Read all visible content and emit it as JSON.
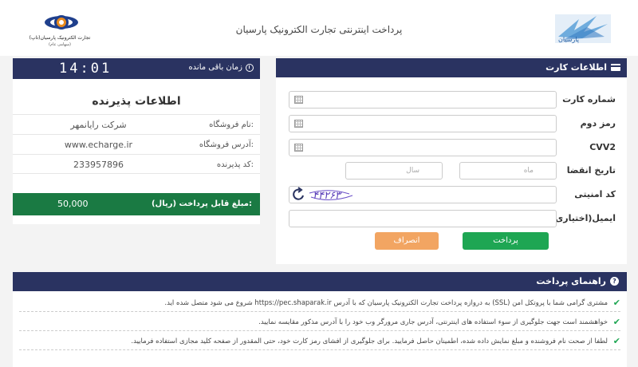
{
  "header": {
    "title": "پرداخت اینترنتی تجارت الکترونیک پارسیان",
    "logo_left_line1": "تجارت الکترونیک پارسیان(تاپ)",
    "logo_left_line2": "(سهامی عام)",
    "logo_right_text": "پارسیان"
  },
  "timer": {
    "label": "زمان باقی مانده",
    "value": "14:01"
  },
  "merchant": {
    "title": "اطلاعات پذیرنده",
    "rows": [
      {
        "label": "نام فروشگاه:",
        "value": "شرکت رایانمهر"
      },
      {
        "label": "آدرس فروشگاه:",
        "value": "www.echarge.ir"
      },
      {
        "label": "کد پذیرنده:",
        "value": "233957896"
      }
    ],
    "amount_label": "مبلغ قابل پرداخت (ریال):",
    "amount_value": "50,000"
  },
  "card_form": {
    "title": "اطلاعات کارت",
    "card_number_label": "شماره کارت",
    "pin_label": "رمز دوم",
    "cvv2_label": "CVV2",
    "expiry_label": "تاریخ انقضا",
    "month_placeholder": "ماه",
    "year_placeholder": "سال",
    "captcha_label": "کد امنیتی",
    "captcha_text": "۴۴۲۶۳",
    "email_label": "ایمیل(اختیاری)",
    "pay_button": "پرداخت",
    "cancel_button": "انصراف"
  },
  "guide": {
    "title": "راهنمای پرداخت",
    "items": [
      "مشتری گرامی شما با پروتکل امن (SSL) به دروازه پرداخت تجارت الکترونیک پارسیان که با آدرس https://pec.shaparak.ir شروع می شود متصل شده اید.",
      "خواهشمند است جهت جلوگیری از سوء استفاده های اینترنتی، آدرس جاری مرورگر وب خود را با آدرس مذکور مقایسه نمایید.",
      "لطفا از صحت نام فروشنده و مبلغ نمایش داده شده، اطمینان حاصل فرمایید. برای جلوگیری از افشای رمز کارت خود، حتی المقدور از صفحه کلید مجازی استفاده فرمایید."
    ]
  },
  "colors": {
    "navy": "#2a3361",
    "green": "#1a7a43",
    "pay_green": "#1ea653",
    "cancel_orange": "#f2a562"
  }
}
